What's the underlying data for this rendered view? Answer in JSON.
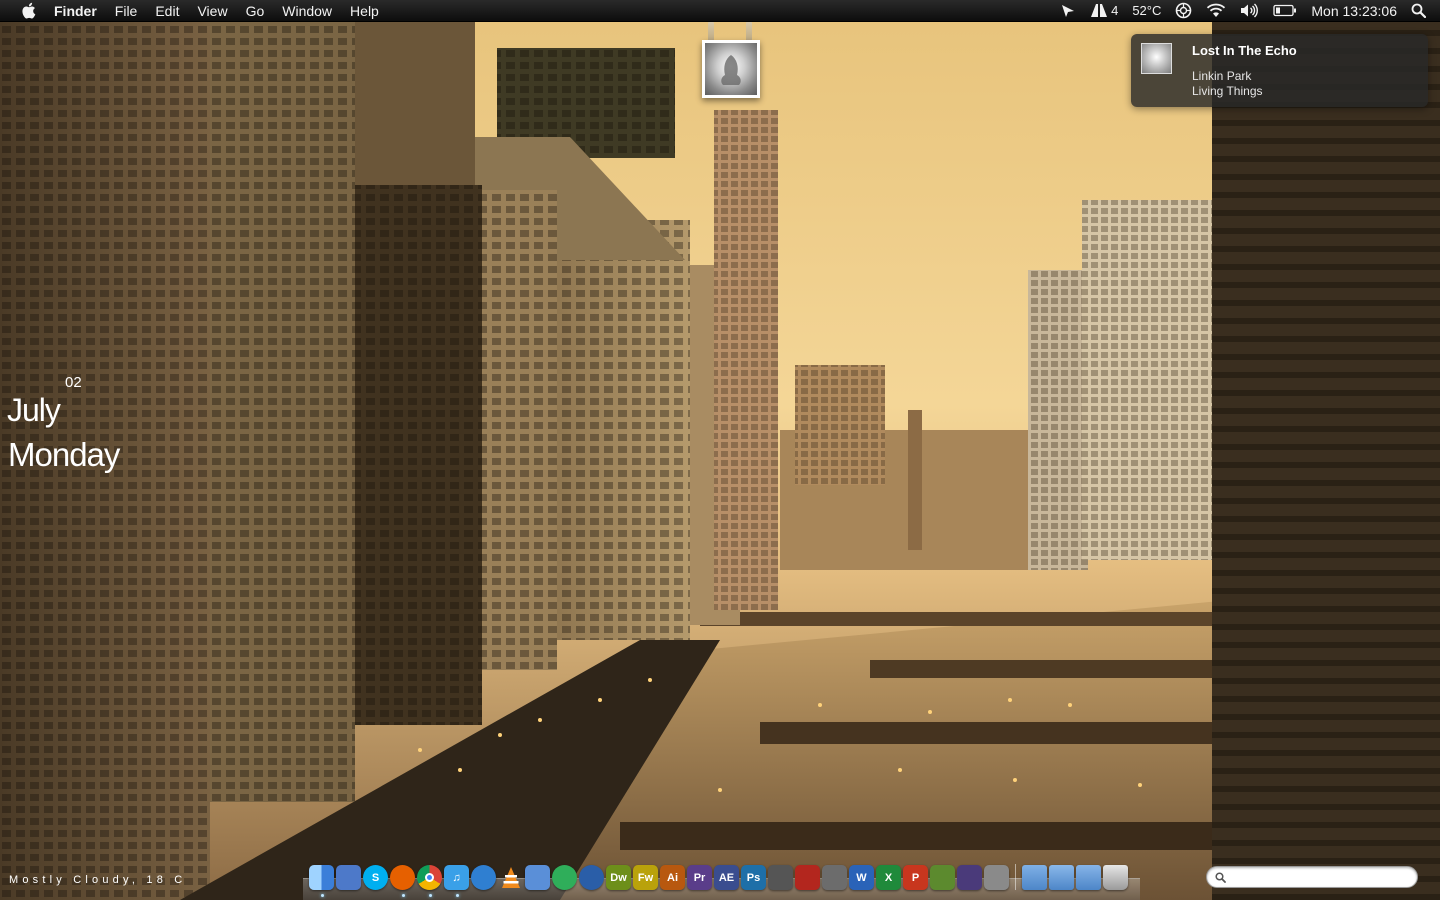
{
  "menubar": {
    "app_name": "Finder",
    "menus": [
      "File",
      "Edit",
      "View",
      "Go",
      "Window",
      "Help"
    ],
    "status": {
      "adobe_count": "4",
      "temperature": "52°C",
      "clock": "Mon 13:23:06"
    }
  },
  "now_playing": {
    "title": "Lost In The Echo",
    "artist": "Linkin Park",
    "album": "Living Things"
  },
  "date_widget": {
    "day": "02",
    "month": "July",
    "weekday": "Monday"
  },
  "weather": {
    "text": "Mostly Cloudy, 18 C"
  },
  "dock": {
    "apps": [
      {
        "name": "finder",
        "label": "",
        "color": "#3b7fd9"
      },
      {
        "name": "mail",
        "label": "",
        "color": "#4d79c9"
      },
      {
        "name": "skype",
        "label": "S",
        "color": "#00aff0"
      },
      {
        "name": "firefox",
        "label": "",
        "color": "#e66000"
      },
      {
        "name": "chrome",
        "label": "",
        "color": "#4caf50"
      },
      {
        "name": "itunes",
        "label": "♫",
        "color": "#3aa0e8"
      },
      {
        "name": "safari",
        "label": "",
        "color": "#2f7fd1"
      },
      {
        "name": "vlc",
        "label": "",
        "color": "#f08a1c"
      },
      {
        "name": "tweetie",
        "label": "",
        "color": "#5a8fd8"
      },
      {
        "name": "messages",
        "label": "",
        "color": "#2fae5a"
      },
      {
        "name": "stream",
        "label": "",
        "color": "#2a5ea8"
      },
      {
        "name": "dreamweaver",
        "label": "Dw",
        "color": "#6d8f1a"
      },
      {
        "name": "fireworks",
        "label": "Fw",
        "color": "#b9a20b"
      },
      {
        "name": "illustrator",
        "label": "Ai",
        "color": "#b8580f"
      },
      {
        "name": "premiere",
        "label": "Pr",
        "color": "#5a3d8a"
      },
      {
        "name": "after-effects",
        "label": "AE",
        "color": "#3a4d8f"
      },
      {
        "name": "photoshop",
        "label": "Ps",
        "color": "#1e6fa8"
      },
      {
        "name": "final-cut",
        "label": "",
        "color": "#555555"
      },
      {
        "name": "photo-booth",
        "label": "",
        "color": "#b3261e"
      },
      {
        "name": "aperture",
        "label": "",
        "color": "#6c6c6c"
      },
      {
        "name": "word",
        "label": "W",
        "color": "#2a63b8"
      },
      {
        "name": "excel",
        "label": "X",
        "color": "#1f8a3b"
      },
      {
        "name": "powerpoint",
        "label": "P",
        "color": "#c8361e"
      },
      {
        "name": "minecraft",
        "label": "",
        "color": "#5c8a2e"
      },
      {
        "name": "wizard",
        "label": "",
        "color": "#4a3a7a"
      },
      {
        "name": "system-preferences",
        "label": "",
        "color": "#8a8a8a"
      }
    ],
    "folders": [
      {
        "name": "applications-folder",
        "color": "#7fb0e6"
      },
      {
        "name": "documents-folder",
        "color": "#8ab8ea"
      },
      {
        "name": "downloads-folder",
        "color": "#86b4e8"
      },
      {
        "name": "trash",
        "color": "#bdbdbd"
      }
    ]
  },
  "search": {
    "placeholder": ""
  }
}
